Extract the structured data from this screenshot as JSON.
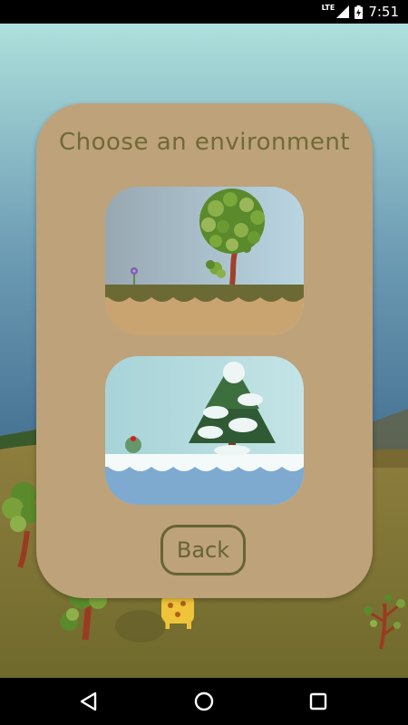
{
  "status_bar": {
    "network_label": "LTE",
    "time": "7:51"
  },
  "dialog": {
    "title": "Choose an environment",
    "options": [
      {
        "name": "grassland-environment"
      },
      {
        "name": "winter-environment"
      }
    ],
    "back_label": "Back"
  },
  "nav_bar": {
    "icons": [
      "back-triangle-icon",
      "home-circle-icon",
      "recents-square-icon"
    ]
  },
  "colors": {
    "dialog_background": "#bea27a",
    "title_text": "#6f6a36",
    "button_border": "#676437",
    "sky_top": "#a9dad8",
    "sky_bottom": "#3f6a8d",
    "ground": "#8c7a3a"
  }
}
